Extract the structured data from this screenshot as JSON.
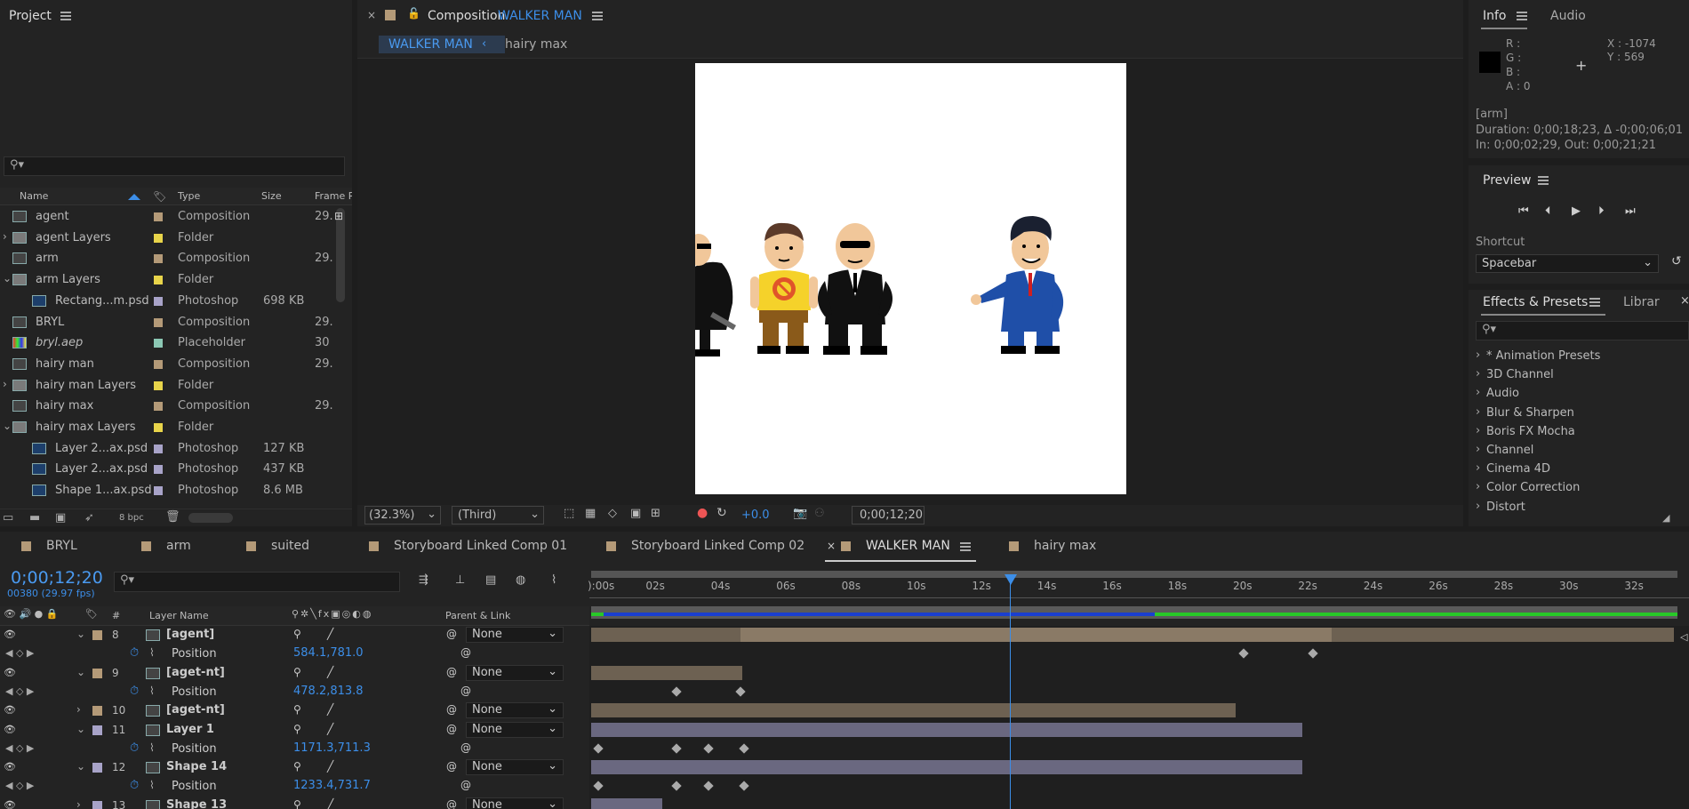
{
  "project": {
    "title": "Project",
    "bpc": "8 bpc",
    "cols": {
      "name": "Name",
      "type": "Type",
      "size": "Size",
      "frame": "Frame R"
    },
    "items": [
      {
        "name": "agent",
        "type": "Composition",
        "size": "",
        "frame": "29.",
        "kind": "comp",
        "color": "#b49a78",
        "indent": 0,
        "arrow": ""
      },
      {
        "name": "agent Layers",
        "type": "Folder",
        "size": "",
        "frame": "",
        "kind": "folder",
        "color": "#e8d44a",
        "indent": 0,
        "arrow": "›"
      },
      {
        "name": "arm",
        "type": "Composition",
        "size": "",
        "frame": "29.",
        "kind": "comp",
        "color": "#b49a78",
        "indent": 0,
        "arrow": ""
      },
      {
        "name": "arm Layers",
        "type": "Folder",
        "size": "",
        "frame": "",
        "kind": "folder",
        "color": "#e8d44a",
        "indent": 0,
        "arrow": "⌄"
      },
      {
        "name": "Rectang...m.psd",
        "type": "Photoshop",
        "size": "698 KB",
        "frame": "",
        "kind": "psd",
        "color": "#a8a3c8",
        "indent": 1,
        "arrow": ""
      },
      {
        "name": "BRYL",
        "type": "Composition",
        "size": "",
        "frame": "29.",
        "kind": "comp",
        "color": "#b49a78",
        "indent": 0,
        "arrow": ""
      },
      {
        "name": "bryl.aep",
        "type": "Placeholder",
        "size": "",
        "frame": "30",
        "kind": "ph",
        "color": "#8cc8b4",
        "indent": 0,
        "arrow": ""
      },
      {
        "name": "hairy man",
        "type": "Composition",
        "size": "",
        "frame": "29.",
        "kind": "comp",
        "color": "#b49a78",
        "indent": 0,
        "arrow": ""
      },
      {
        "name": "hairy man Layers",
        "type": "Folder",
        "size": "",
        "frame": "",
        "kind": "folder",
        "color": "#e8d44a",
        "indent": 0,
        "arrow": "›"
      },
      {
        "name": "hairy max",
        "type": "Composition",
        "size": "",
        "frame": "29.",
        "kind": "comp",
        "color": "#b49a78",
        "indent": 0,
        "arrow": ""
      },
      {
        "name": "hairy max Layers",
        "type": "Folder",
        "size": "",
        "frame": "",
        "kind": "folder",
        "color": "#e8d44a",
        "indent": 0,
        "arrow": "⌄"
      },
      {
        "name": "Layer 2...ax.psd",
        "type": "Photoshop",
        "size": "127 KB",
        "frame": "",
        "kind": "psd",
        "color": "#a8a3c8",
        "indent": 1,
        "arrow": ""
      },
      {
        "name": "Layer 2...ax.psd",
        "type": "Photoshop",
        "size": "437 KB",
        "frame": "",
        "kind": "psd",
        "color": "#a8a3c8",
        "indent": 1,
        "arrow": ""
      },
      {
        "name": "Shape 1...ax.psd",
        "type": "Photoshop",
        "size": "8.6 MB",
        "frame": "",
        "kind": "psd",
        "color": "#a8a3c8",
        "indent": 1,
        "arrow": ""
      }
    ]
  },
  "comp": {
    "prefix": "Composition",
    "name": "WALKER MAN",
    "crumb1": "WALKER MAN",
    "crumb2": "hairy max",
    "zoom": "(32.3%)",
    "res": "(Third)",
    "exposure": "+0.0",
    "time": "0;00;12;20"
  },
  "info": {
    "tab1": "Info",
    "tab2": "Audio",
    "r": "R :",
    "g": "G :",
    "b": "B :",
    "a": "A :  0",
    "x": "X : -1074",
    "y": "Y : 569",
    "layer": "[arm]",
    "duration": "Duration: 0;00;18;23, Δ -0;00;06;01",
    "inout": "In: 0;00;02;29, Out: 0;00;21;21"
  },
  "preview": {
    "title": "Preview",
    "shortcut_label": "Shortcut",
    "shortcut": "Spacebar"
  },
  "effects": {
    "tab1": "Effects & Presets",
    "tab2": "Librar",
    "items": [
      "* Animation Presets",
      "3D Channel",
      "Audio",
      "Blur & Sharpen",
      "Boris FX Mocha",
      "Channel",
      "Cinema 4D",
      "Color Correction",
      "Distort"
    ]
  },
  "timeline": {
    "tabs": [
      "BRYL",
      "arm",
      "suited",
      "Storyboard Linked Comp 01",
      "Storyboard Linked Comp 02",
      "WALKER MAN",
      "hairy max"
    ],
    "time": "0;00;12;20",
    "fps": "00380 (29.97 fps)",
    "cols": {
      "num": "#",
      "name": "Layer Name",
      "parent": "Parent & Link"
    },
    "ruler": [
      "):00s",
      "02s",
      "04s",
      "06s",
      "08s",
      "10s",
      "12s",
      "14s",
      "16s",
      "18s",
      "20s",
      "22s",
      "24s",
      "26s",
      "28s",
      "30s",
      "32s"
    ],
    "layers": [
      {
        "num": "8",
        "name": "[agent]",
        "parent": "None",
        "color": "#b49a78",
        "prop": "Position",
        "value": "584.1,781.0"
      },
      {
        "num": "9",
        "name": "[aget-nt]",
        "parent": "None",
        "color": "#b49a78",
        "prop": "Position",
        "value": "478.2,813.8"
      },
      {
        "num": "10",
        "name": "[aget-nt]",
        "parent": "None",
        "color": "#b49a78"
      },
      {
        "num": "11",
        "name": "Layer 1",
        "parent": "None",
        "color": "#a8a3c8",
        "prop": "Position",
        "value": "1171.3,711.3"
      },
      {
        "num": "12",
        "name": "Shape 14",
        "parent": "None",
        "color": "#a8a3c8",
        "prop": "Position",
        "value": "1233.4,731.7"
      },
      {
        "num": "13",
        "name": "Shape 13",
        "parent": "None",
        "color": "#a8a3c8"
      }
    ]
  }
}
